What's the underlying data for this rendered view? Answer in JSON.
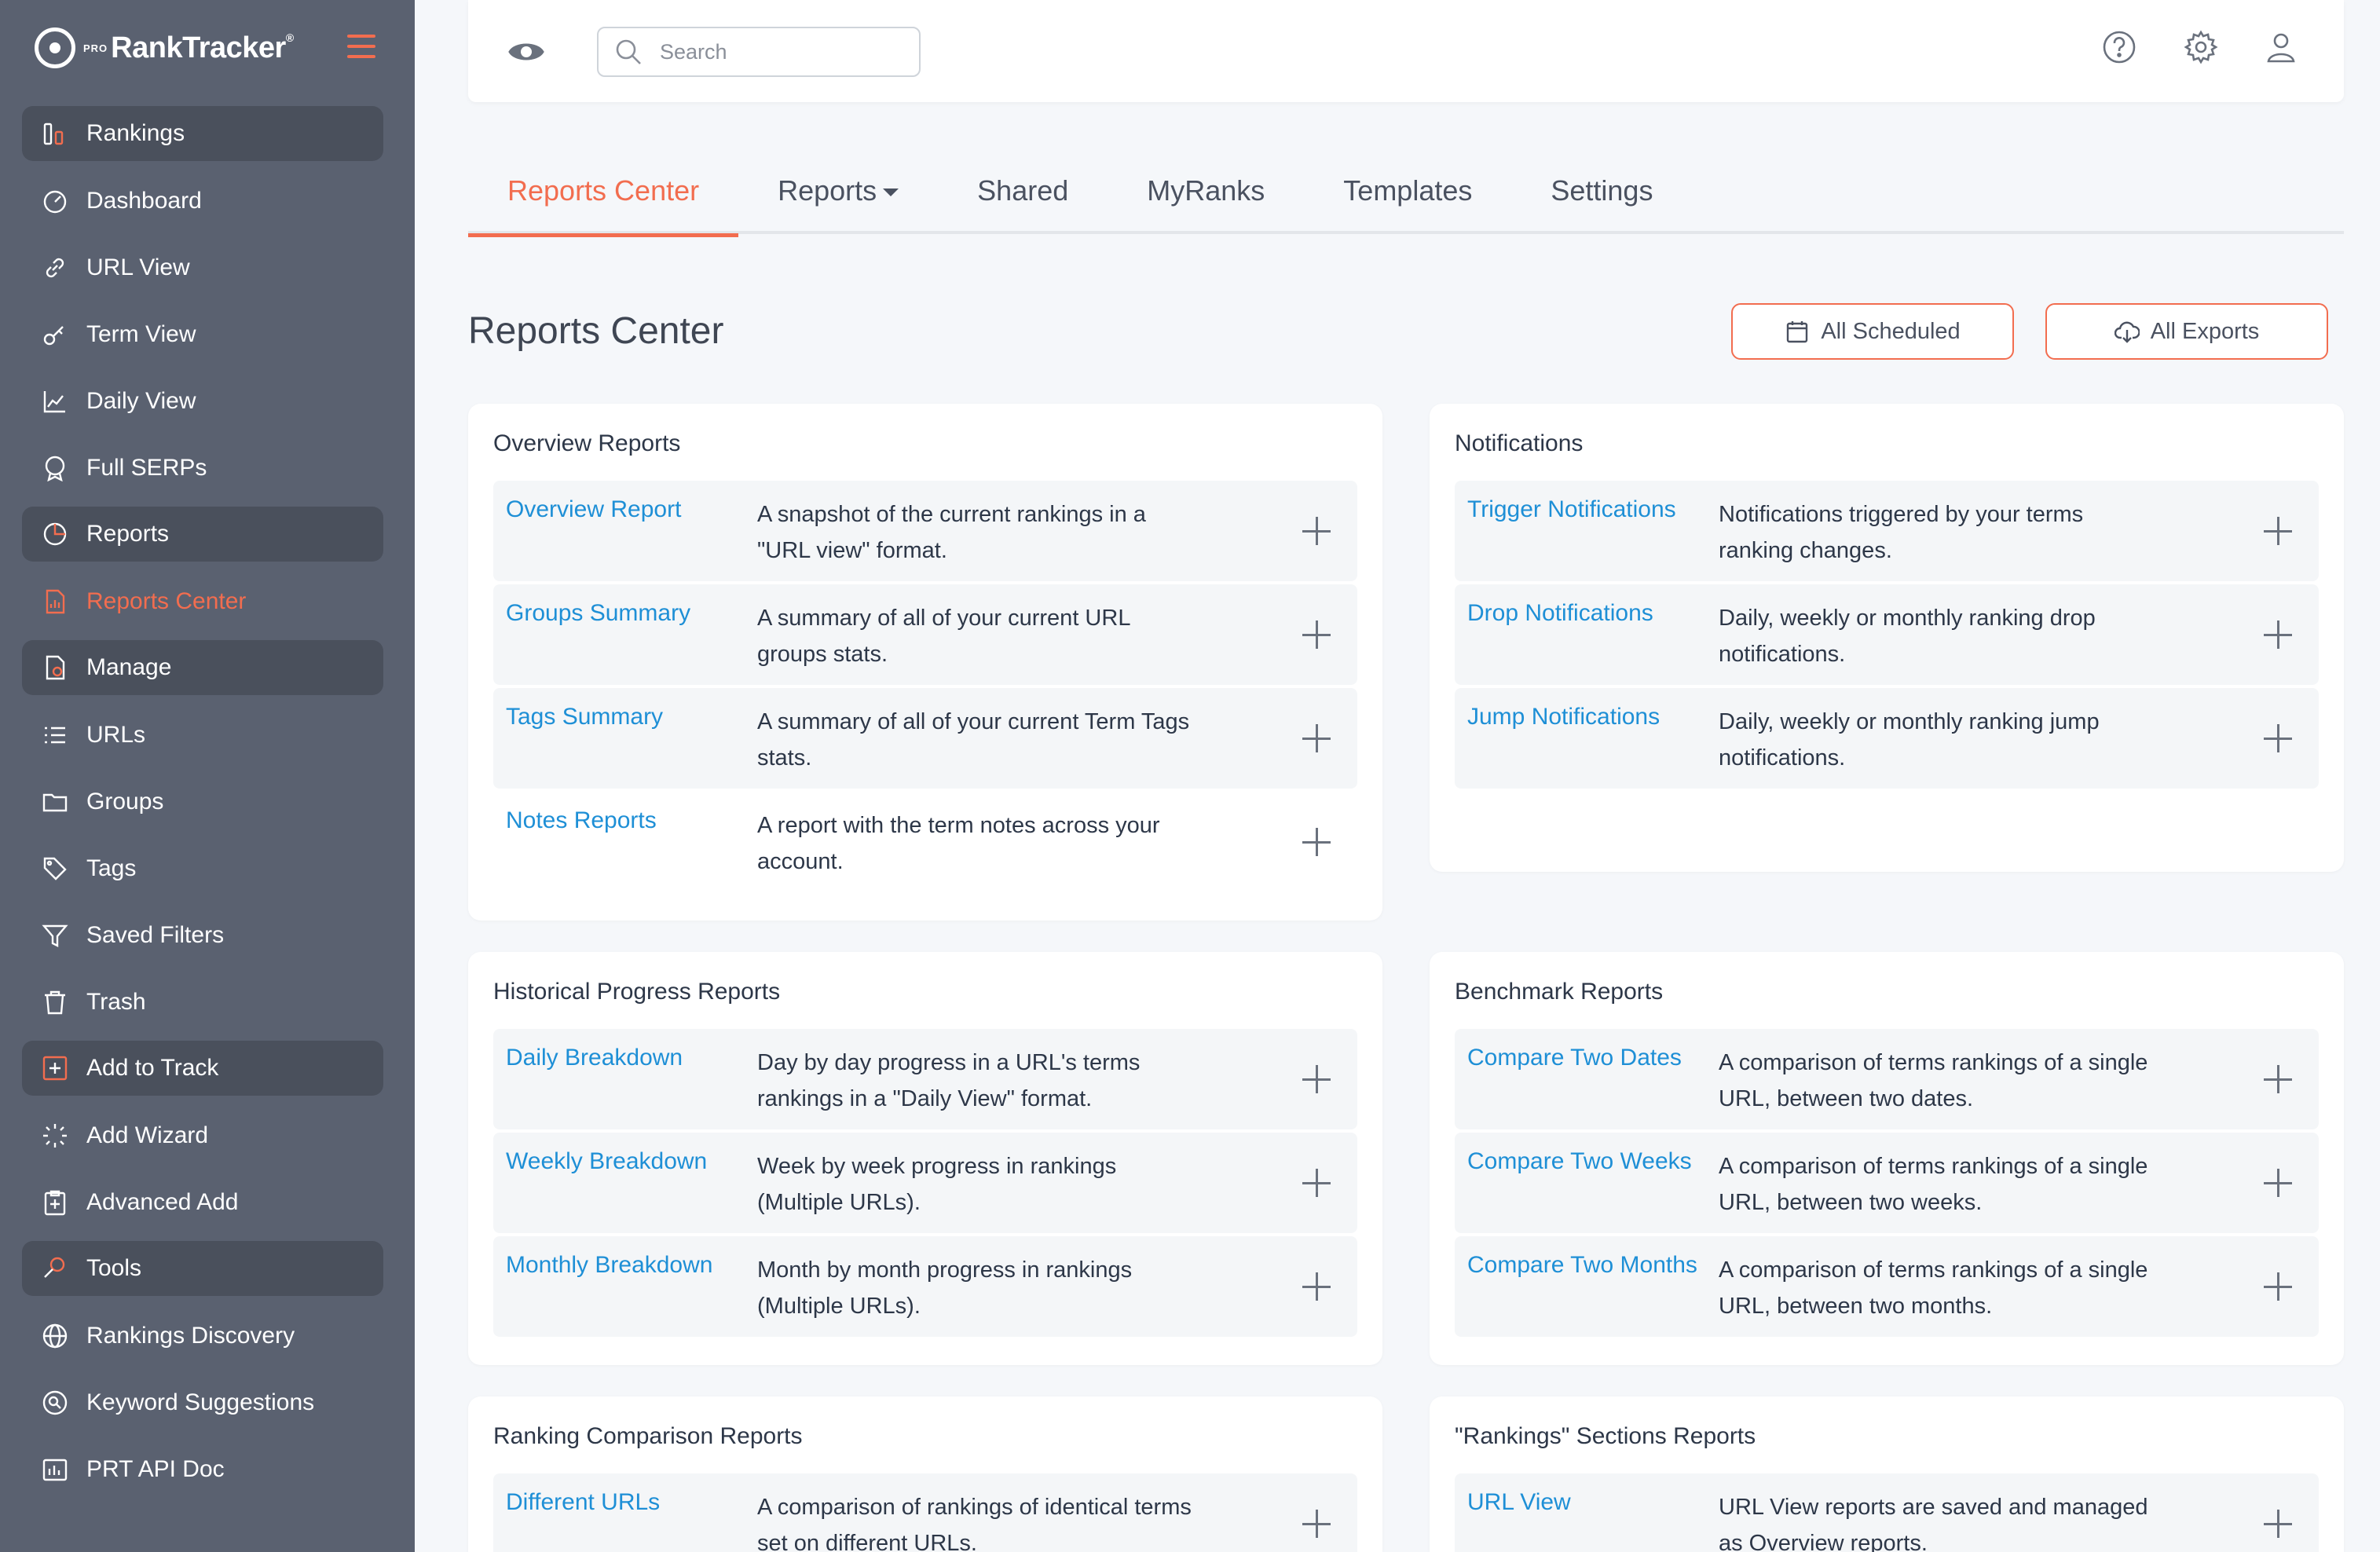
{
  "brand": {
    "small": "PRO",
    "name": "RankTracker",
    "mark": "®"
  },
  "sidebar": {
    "items": [
      {
        "label": "Rankings",
        "icon": "rankings-icon",
        "section": true
      },
      {
        "label": "Dashboard",
        "icon": "dashboard-icon"
      },
      {
        "label": "URL View",
        "icon": "link-icon"
      },
      {
        "label": "Term View",
        "icon": "key-icon"
      },
      {
        "label": "Daily View",
        "icon": "line-chart-icon"
      },
      {
        "label": "Full SERPs",
        "icon": "serp-badge-icon"
      },
      {
        "label": "Reports",
        "icon": "pie-chart-icon",
        "section": true
      },
      {
        "label": "Reports Center",
        "icon": "report-icon",
        "active": true
      },
      {
        "label": "Manage",
        "icon": "manage-icon",
        "section": true
      },
      {
        "label": "URLs",
        "icon": "list-icon"
      },
      {
        "label": "Groups",
        "icon": "folder-icon"
      },
      {
        "label": "Tags",
        "icon": "tag-icon"
      },
      {
        "label": "Saved Filters",
        "icon": "filter-icon"
      },
      {
        "label": "Trash",
        "icon": "trash-icon"
      },
      {
        "label": "Add to Track",
        "icon": "plus-square-icon",
        "section": true
      },
      {
        "label": "Add Wizard",
        "icon": "wizard-icon"
      },
      {
        "label": "Advanced Add",
        "icon": "clipboard-plus-icon"
      },
      {
        "label": "Tools",
        "icon": "tools-icon",
        "section": true
      },
      {
        "label": "Rankings Discovery",
        "icon": "globe-icon"
      },
      {
        "label": "Keyword Suggestions",
        "icon": "search-circle-icon"
      },
      {
        "label": "PRT API Doc",
        "icon": "api-icon"
      }
    ]
  },
  "topbar": {
    "search_placeholder": "Search"
  },
  "tabs": [
    {
      "label": "Reports Center",
      "active": true
    },
    {
      "label": "Reports",
      "dropdown": true
    },
    {
      "label": "Shared"
    },
    {
      "label": "MyRanks"
    },
    {
      "label": "Templates"
    },
    {
      "label": "Settings"
    }
  ],
  "page": {
    "title": "Reports Center",
    "all_scheduled": "All Scheduled",
    "all_exports": "All Exports"
  },
  "cards": {
    "overview": {
      "title": "Overview Reports",
      "rows": [
        {
          "link": "Overview Report",
          "desc": "A snapshot of the current rankings in a \"URL view\" format."
        },
        {
          "link": "Groups Summary",
          "desc": "A summary of all of your current URL groups stats."
        },
        {
          "link": "Tags Summary",
          "desc": "A summary of all of your current Term Tags stats."
        },
        {
          "link": "Notes Reports",
          "desc": "A report with the term notes across your account."
        }
      ]
    },
    "notifications": {
      "title": "Notifications",
      "rows": [
        {
          "link": "Trigger Notifications",
          "desc": "Notifications triggered by your terms ranking changes."
        },
        {
          "link": "Drop Notifications",
          "desc": "Daily, weekly or monthly ranking drop notifications."
        },
        {
          "link": "Jump Notifications",
          "desc": "Daily, weekly or monthly ranking jump notifications."
        }
      ]
    },
    "historical": {
      "title": "Historical Progress Reports",
      "rows": [
        {
          "link": "Daily Breakdown",
          "desc": "Day by day progress in a URL's terms rankings in a \"Daily View\" format."
        },
        {
          "link": "Weekly Breakdown",
          "desc": "Week by week progress in rankings (Multiple URLs)."
        },
        {
          "link": "Monthly Breakdown",
          "desc": "Month by month progress in rankings (Multiple URLs)."
        }
      ]
    },
    "benchmark": {
      "title": "Benchmark Reports",
      "rows": [
        {
          "link": "Compare Two Dates",
          "desc": "A comparison of terms rankings of a single URL, between two dates."
        },
        {
          "link": "Compare Two Weeks",
          "desc": "A comparison of terms rankings of a single URL, between two weeks."
        },
        {
          "link": "Compare Two Months",
          "desc": "A comparison of terms rankings of a single URL, between two months."
        }
      ]
    },
    "comparison": {
      "title": "Ranking Comparison Reports",
      "rows": [
        {
          "link": "Different URLs",
          "desc": "A comparison of rankings of identical terms set on different URLs."
        }
      ]
    },
    "sections": {
      "title": "\"Rankings\" Sections Reports",
      "rows": [
        {
          "link": "URL View",
          "desc": "URL View reports are saved and managed as Overview reports."
        }
      ]
    }
  },
  "colors": {
    "accent": "#f26d4f",
    "link": "#1e8fd6",
    "sidebar": "#5a6170",
    "sidebar_section": "#4a505c"
  }
}
